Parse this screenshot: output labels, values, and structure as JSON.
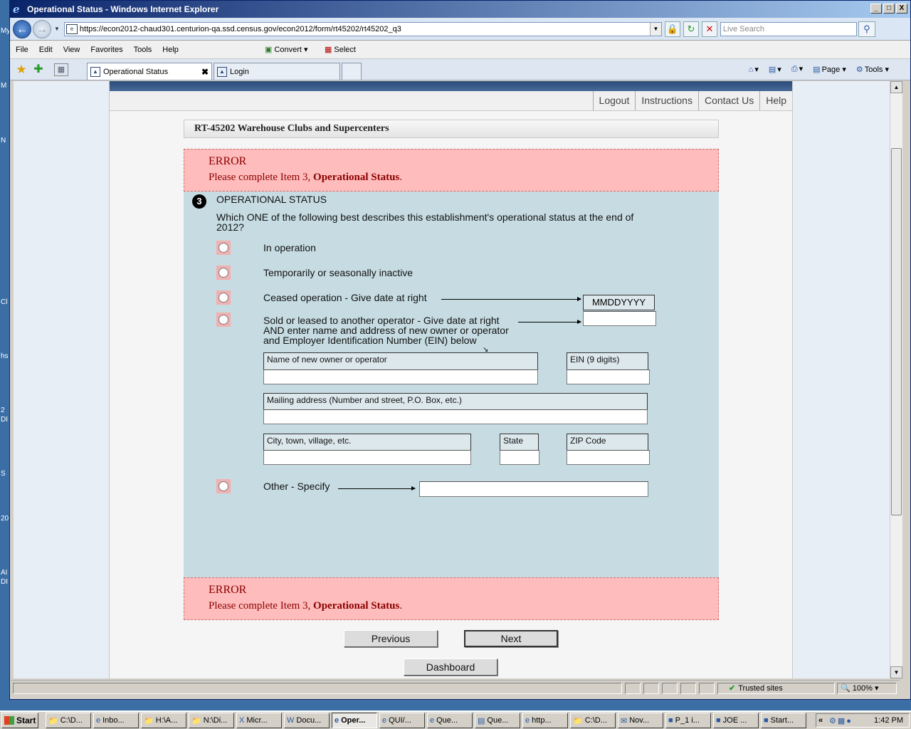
{
  "window": {
    "title": "Operational Status - Windows Internet Explorer",
    "controls": [
      "_",
      "□",
      "X"
    ]
  },
  "addressbar": {
    "url": "https://econ2012-chaud301.centurion-qa.ssd.census.gov/econ2012/form/rt45202/rt45202_q3",
    "search_placeholder": "Live Search"
  },
  "menubar": {
    "items": [
      "File",
      "Edit",
      "View",
      "Favorites",
      "Tools",
      "Help"
    ],
    "convert_label": "Convert",
    "select_label": "Select"
  },
  "tabs": {
    "active_label": "Operational Status",
    "login_label": "Login"
  },
  "commandbar": {
    "page_label": "Page",
    "tools_label": "Tools"
  },
  "topnav": {
    "logout": "Logout",
    "instructions": "Instructions",
    "contact": "Contact Us",
    "help": "Help"
  },
  "form": {
    "title": "RT-45202 Warehouse Clubs and Supercenters"
  },
  "error": {
    "title": "ERROR",
    "message_prefix": "Please complete Item 3, ",
    "message_bold": "Operational Status",
    "message_suffix": "."
  },
  "question": {
    "number": "3",
    "title": "OPERATIONAL STATUS",
    "text": "Which ONE of the following best describes this establishment's operational status at the end of 2012?",
    "options": {
      "in_operation": "In operation",
      "inactive": "Temporarily or seasonally inactive",
      "ceased": "Ceased operation - Give date at right",
      "sold_line1": "Sold or leased to another operator - Give date at right",
      "sold_line2": "AND enter name and address of new owner or operator",
      "sold_line3": "and Employer Identification Number (EIN) below",
      "other": "Other - Specify"
    },
    "date_format": "MMDDYYYY",
    "fields": {
      "owner_name": "Name of new owner or operator",
      "ein": "EIN (9 digits)",
      "mailing_address": "Mailing address (Number and street, P.O. Box, etc.)",
      "city": "City, town, village, etc.",
      "state": "State",
      "zip": "ZIP Code"
    }
  },
  "buttons": {
    "previous": "Previous",
    "next": "Next",
    "dashboard": "Dashboard"
  },
  "statusbar": {
    "zone": "Trusted sites",
    "zoom": "100%"
  },
  "taskbar": {
    "start": "Start",
    "items": [
      "C:\\D...",
      "Inbo...",
      "H:\\A...",
      "N:\\Di...",
      "Micr...",
      "Docu...",
      "Oper...",
      "QUI/...",
      "Que...",
      "Que...",
      "http...",
      "C:\\D...",
      "Nov...",
      "P_1 i...",
      "JOE ...",
      "Start..."
    ],
    "clock": "1:42 PM"
  },
  "desktop_labels": [
    "My",
    "M",
    "N",
    "Cl",
    "hs",
    "2",
    "DI",
    "S",
    "20",
    "AI",
    "DI"
  ]
}
